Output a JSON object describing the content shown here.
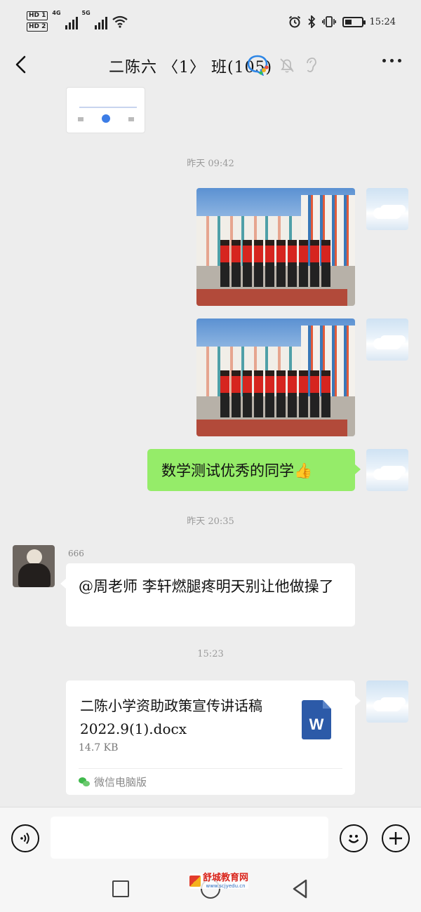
{
  "status_bar": {
    "sim1": "HD 1",
    "sim2": "HD 2",
    "net1": "4G",
    "net2": "5G",
    "time": "15:24"
  },
  "header": {
    "title": "二陈六 〈1〉 班(105)"
  },
  "messages": {
    "time1": "昨天 09:42",
    "time2": "昨天 20:35",
    "time3": "15:23",
    "me_text": "数学测试优秀的同学",
    "me_emoji": "👍",
    "other_sender": "666",
    "other_text": "@周老师  李轩燃腿疼明天别让他做操了"
  },
  "file": {
    "name": "二陈小学资助政策宣传讲话稿 2022.9(1).docx",
    "size": "14.7 KB",
    "icon_letter": "W",
    "source": "微信电脑版"
  },
  "input": {
    "value": ""
  },
  "watermark": {
    "name": "舒城教育网",
    "url": "www.scjyedu.cn"
  }
}
